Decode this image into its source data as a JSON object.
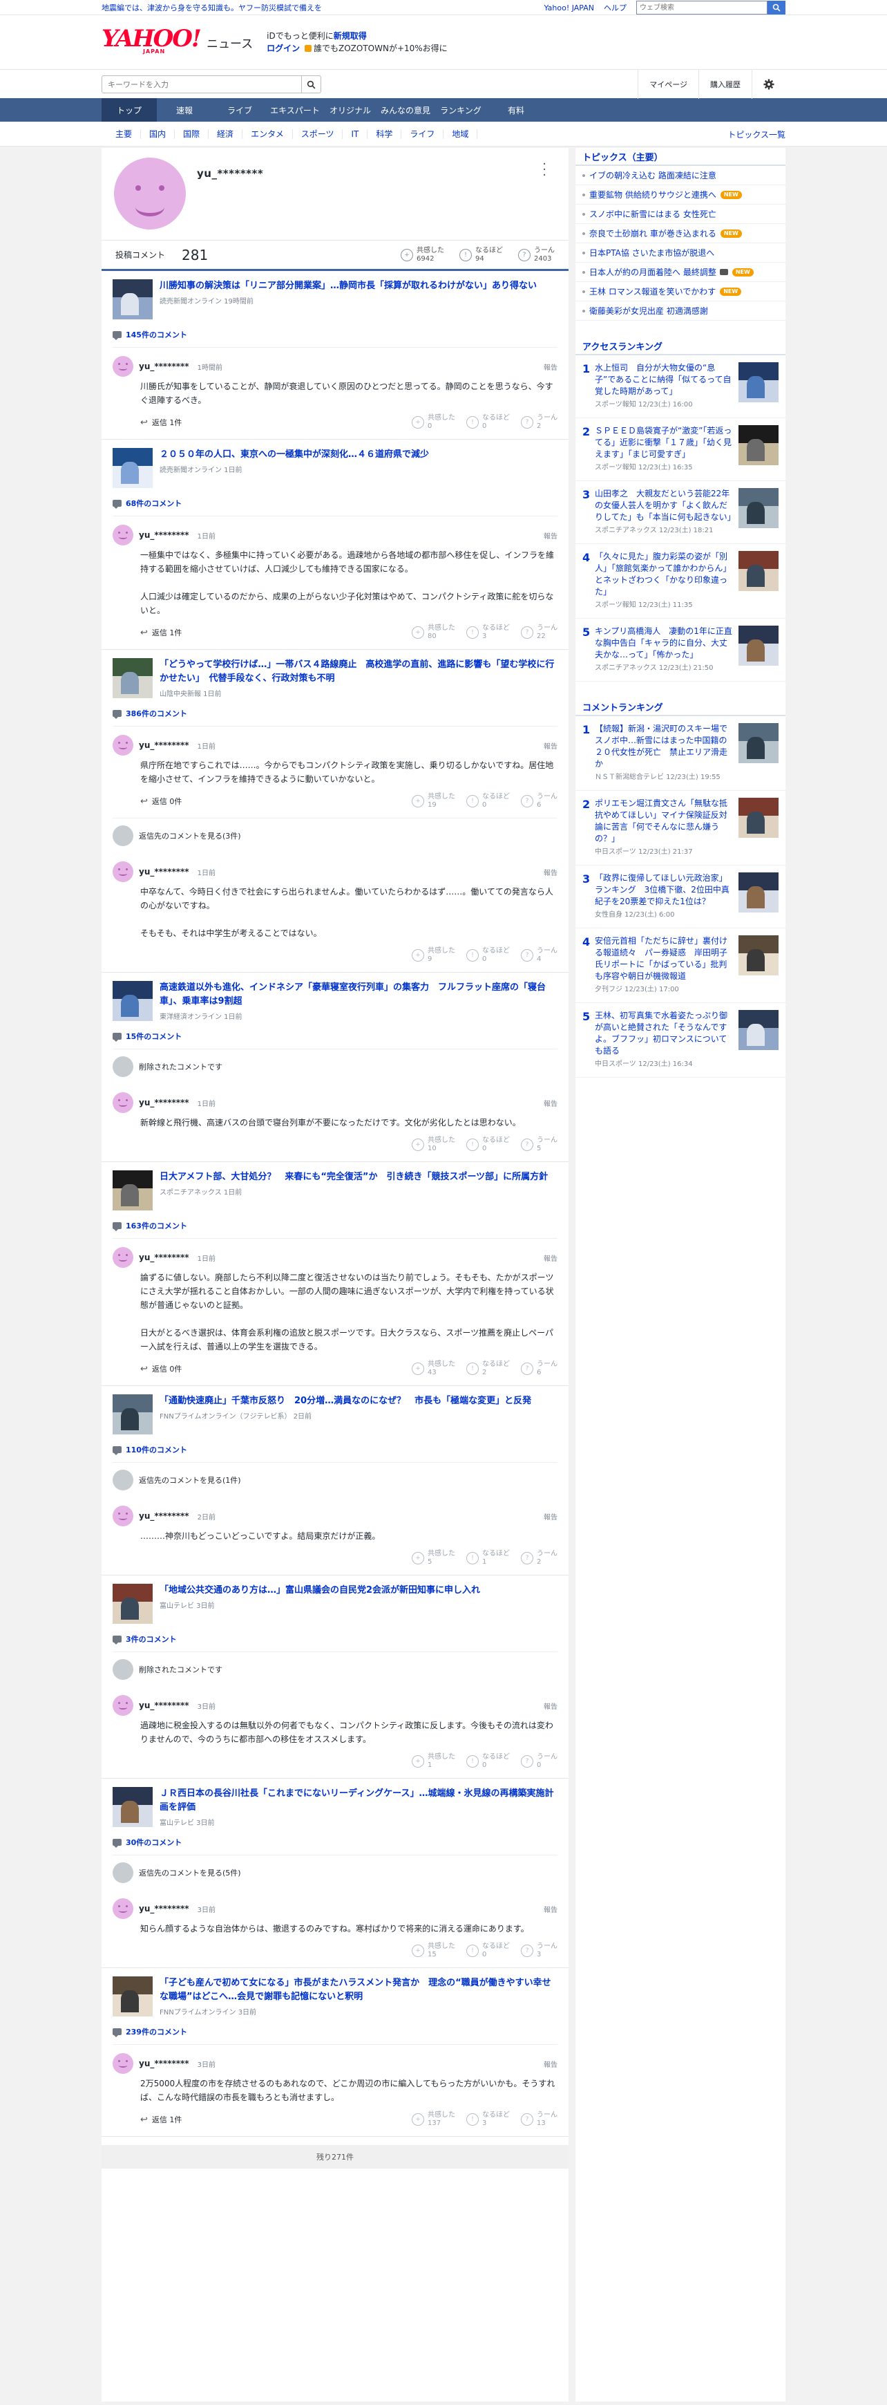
{
  "promo": {
    "left": "地震編では、津波から身を守る知識も。ヤフー防災模試で備えを",
    "yahoo_japan": "Yahoo! JAPAN",
    "help": "ヘルプ",
    "web_search_placeholder": "ウェブ検索"
  },
  "header": {
    "logo_text": "YAHOO!",
    "logo_sub": "JAPAN",
    "site_name": "ニュース",
    "msg_line1_pre": "iDでもっと便利に",
    "msg_line1_link": "新規取得",
    "msg_line2_link": "ログイン",
    "msg_line2_post": "誰でもZOZOTOWNが+10%お得に"
  },
  "toolbar": {
    "keyword_placeholder": "キーワードを入力",
    "mypage": "マイページ",
    "purchase_history": "購入履歴"
  },
  "nav": [
    "トップ",
    "速報",
    "ライブ",
    "エキスパート",
    "オリジナル",
    "みんなの意見",
    "ランキング",
    "有料"
  ],
  "subnav": {
    "items": [
      "主要",
      "国内",
      "国際",
      "経済",
      "エンタメ",
      "スポーツ",
      "IT",
      "科学",
      "ライフ",
      "地域"
    ],
    "topics_list": "トピックス一覧"
  },
  "profile": {
    "username": "yu_********",
    "comment_label": "投稿コメント",
    "comment_count": "281",
    "reactions": [
      {
        "label": "共感した",
        "count": "6942"
      },
      {
        "label": "なるほど",
        "count": "94"
      },
      {
        "label": "うーん",
        "count": "2403"
      }
    ]
  },
  "articles": [
    {
      "title": "川勝知事の解決策は「リニア部分開業案」…静岡市長「採算が取れるわけがない」あり得ない",
      "source": "読売新聞オンライン 19時間前",
      "count": "145件のコメント",
      "comments": [
        {
          "user": "yu_********",
          "time": "1時間前",
          "body": "川勝氏が知事をしていることが、静岡が衰退していく原因のひとつだと思ってる。静岡のことを思うなら、今すぐ退陣するべき。",
          "reply": "返信 1件",
          "v1": "0",
          "v2": "0",
          "v3": "2"
        }
      ]
    },
    {
      "title": "２０５０年の人口、東京への一極集中が深刻化…４６道府県で減少",
      "source": "読売新聞オンライン 1日前",
      "count": "68件のコメント",
      "comments": [
        {
          "user": "yu_********",
          "time": "1日前",
          "body": "一極集中ではなく、多極集中に持っていく必要がある。過疎地から各地域の都市部へ移住を促し、インフラを維持する範囲を縮小させていけば、人口減少しても維持できる国家になる。\n\n人口減少は確定しているのだから、成果の上がらない少子化対策はやめて、コンパクトシティ政策に舵を切らないと。",
          "reply": "返信 1件",
          "v1": "80",
          "v2": "3",
          "v3": "22"
        }
      ]
    },
    {
      "title": "「どうやって学校行けば…」一帯バス４路線廃止　高校進学の直前、進路に影響も「望む学校に行かせたい」　代替手段なく、行政対策も不明",
      "source": "山陰中央新報 1日前",
      "count": "386件のコメント",
      "comments": [
        {
          "user": "yu_********",
          "time": "1日前",
          "body": "県庁所在地ですらこれでは……。今からでもコンパクトシティ政策を実施し、乗り切るしかないですね。居住地を縮小させて、インフラを維持できるように動いていかないと。",
          "reply": "返信 0件",
          "v1": "19",
          "v2": "0",
          "v3": "6"
        }
      ],
      "sub_rows": [
        {
          "text": "返信先のコメントを見る(3件)"
        }
      ],
      "comments2": [
        {
          "user": "yu_********",
          "time": "1日前",
          "body": "中卒なんて、今時日く付きで社会にすら出られませんよ。働いていたらわかるはず……。働いてての発言なら人の心がないですね。\n\nそもそも、それは中学生が考えることではない。",
          "v1": "9",
          "v2": "0",
          "v3": "4"
        }
      ]
    },
    {
      "title": "高速鉄道以外も進化、インドネシア「豪華寝室夜行列車」の集客力　フルフラット座席の「寝台車」、乗車率は9割超",
      "source": "東洋経済オンライン 1日前",
      "count": "15件のコメント",
      "sub_rows": [
        {
          "text": "削除されたコメントです"
        }
      ],
      "comments2": [
        {
          "user": "yu_********",
          "time": "1日前",
          "body": "新幹線と飛行機、高速バスの台頭で寝台列車が不要になっただけです。文化が劣化したとは思わない。",
          "v1": "10",
          "v2": "0",
          "v3": "5"
        }
      ]
    },
    {
      "title": "日大アメフト部、大甘処分？　来春にも“完全復活”か　引き続き「競技スポーツ部」に所属方針",
      "source": "スポニチアネックス 1日前",
      "count": "163件のコメント",
      "comments": [
        {
          "user": "yu_********",
          "time": "1日前",
          "body": "論ずるに値しない。廃部したら不利以降二度と復活させないのは当たり前でしょう。そもそも、たかがスポーツにさえ大学が揺れること自体おかしい。一部の人間の趣味に過ぎないスポーツが、大学内で利権を持っている状態が普通じゃないのと証拠。\n\n日大がとるべき選択は、体育会系利権の追放と脱スポーツです。日大クラスなら、スポーツ推薦を廃止しペーパー入試を行えば、普通以上の学生を選抜できる。",
          "reply": "返信 0件",
          "v1": "43",
          "v2": "2",
          "v3": "6"
        }
      ]
    },
    {
      "title": "「通勤快速廃止」千葉市反怒り　20分増…満員なのになぜ？　市長も「極端な変更」と反発",
      "source": "FNNプライムオンライン（フジテレビ系） 2日前",
      "count": "110件のコメント",
      "sub_rows": [
        {
          "text": "返信先のコメントを見る(1件)"
        }
      ],
      "comments2": [
        {
          "user": "yu_********",
          "time": "2日前",
          "body": "………神奈川もどっこいどっこいですよ。結局東京だけが正義。",
          "v1": "5",
          "v2": "1",
          "v3": "2"
        }
      ]
    },
    {
      "title": "「地域公共交通のあり方は…」富山県議会の自民党2会派が新田知事に申し入れ",
      "source": "富山テレビ 3日前",
      "count": "3件のコメント",
      "sub_rows": [
        {
          "text": "削除されたコメントです"
        }
      ],
      "comments2": [
        {
          "user": "yu_********",
          "time": "3日前",
          "body": "過疎地に税金投入するのは無駄以外の何者でもなく、コンパクトシティ政策に反します。今後もその流れは変わりませんので、今のうちに都市部への移住をオススメします。",
          "v1": "1",
          "v2": "0",
          "v3": "0"
        }
      ]
    },
    {
      "title": "ＪＲ西日本の長谷川社長「これまでにないリーディングケース」…城端線・氷見線の再構築実施計画を評価",
      "source": "富山テレビ 3日前",
      "count": "30件のコメント",
      "sub_rows": [
        {
          "text": "返信先のコメントを見る(5件)"
        }
      ],
      "comments2": [
        {
          "user": "yu_********",
          "time": "3日前",
          "body": "知らん顔するような自治体からは、撤退するのみですね。寒村ばかりで将来的に消える運命にあります。",
          "v1": "15",
          "v2": "0",
          "v3": "3"
        }
      ]
    },
    {
      "title": "「子ども産んで初めて女になる」市長がまたハラスメント発言か　理念の“職員が働きやすい幸せな職場”はどこへ…会見で謝罪も記憶にないと釈明",
      "source": "FNNプライムオンライン 3日前",
      "count": "239件のコメント",
      "comments": [
        {
          "user": "yu_********",
          "time": "3日前",
          "body": "2万5000人程度の市を存続させるのもあれなので、どこか周辺の市に編入してもらった方がいいかも。そうすれば、こんな時代錯誤の市長を職もろとも消せますし。",
          "reply": "返信 1件",
          "v1": "137",
          "v2": "3",
          "v3": "13"
        }
      ]
    }
  ],
  "more": "残り271件",
  "report_label": "報告",
  "vote_labels": [
    "共感した",
    "なるほど",
    "うーん"
  ],
  "sidebar": {
    "topics_title": "トピックス（主要）",
    "topics": [
      {
        "text": "イブの朝冷え込む 路面凍結に注意",
        "new": false,
        "cam": false
      },
      {
        "text": "重要鉱物 供給続りサウジと連携へ",
        "new": true,
        "cam": false
      },
      {
        "text": "スノボ中に新雪にはまる 女性死亡",
        "new": false,
        "cam": false
      },
      {
        "text": "奈良で土砂崩れ 車が巻き込まれる",
        "new": true,
        "cam": false
      },
      {
        "text": "日本PTA協 さいたま市協が脱退へ",
        "new": false,
        "cam": false
      },
      {
        "text": "日本人が約の月面着陸へ 最終調整",
        "new": true,
        "cam": true
      },
      {
        "text": "王林 ロマンス報道を笑いでかわす",
        "new": true,
        "cam": false
      },
      {
        "text": "衛藤美彩が女児出産 初適満感謝",
        "new": false,
        "cam": false
      }
    ],
    "new_label": "NEW",
    "access_title": "アクセスランキング",
    "access": [
      {
        "num": "1",
        "text": "水上恒司　自分が大物女優の“息子”であることに納得「似てるって自覚した時期があって」",
        "src": "スポーツ報知 12/23(土) 16:00"
      },
      {
        "num": "2",
        "text": "ＳＰＥＥＤ島袋寛子が“激変”「若返ってる」近影に衝撃「１７歳」「幼く見えます」「まじ可愛すぎ」",
        "src": "スポーツ報知 12/23(土) 16:35"
      },
      {
        "num": "3",
        "text": "山田孝之　大親友だという芸能22年の女優人芸人を明かす「よく飲んだりしてた」も「本当に何も起きない」",
        "src": "スポニチアネックス 12/23(土) 18:21"
      },
      {
        "num": "4",
        "text": "「久々に見た」腹力彩菜の姿が「別人」「旅館気楽かって誰かわからん」とネットざわつく「かなり印象違った」",
        "src": "スポーツ報知 12/23(土) 11:35"
      },
      {
        "num": "5",
        "text": "キンプリ高橋海人　凄動の1年に正直な胸中告白「キャラ的に自分、大丈夫かな…って」「怖かった」",
        "src": "スポニチアネックス 12/23(土) 21:50"
      }
    ],
    "comment_title": "コメントランキング",
    "comment_rank": [
      {
        "num": "1",
        "text": "【続報】新潟・湯沢町のスキー場でスノボ中…新雪にはまった中国籍の２０代女性が死亡　禁止エリア滑走か",
        "src": "ＮＳＴ新潟総合テレビ 12/23(土) 19:55"
      },
      {
        "num": "2",
        "text": "ポリエモン堀江貴文さん「無駄な抵抗やめてほしい」マイナ保険証反対論に苦言「何でそんなに悲ん嫌うの？」",
        "src": "中日スポーツ 12/23(土) 21:37"
      },
      {
        "num": "3",
        "text": "「政界に復帰してほしい元政治家」ランキング　3位橋下徹、2位田中真紀子を20票差で抑えた1位は？",
        "src": "女性自身 12/23(土) 6:00"
      },
      {
        "num": "4",
        "text": "安倍元首相「ただちに辞せ」裏付ける報道続々　パー券疑惑　岸田明子氏リポートに「かばっている」批判も序容や朝日が機微報道",
        "src": "夕刊フジ 12/23(土) 17:00"
      },
      {
        "num": "5",
        "text": "王林、初写真集で水着姿たっぷり御が高いと絶賛された「そうなんですよ。ブフフッ」初ロマンスについても語る",
        "src": "中日スポーツ 12/23(土) 16:34"
      }
    ]
  },
  "colors": {
    "brand": "#ff0033",
    "link": "#0033cc",
    "nav": "#3e5e8e",
    "nav_active": "#26406a",
    "avatar": "#e6b3e6"
  }
}
